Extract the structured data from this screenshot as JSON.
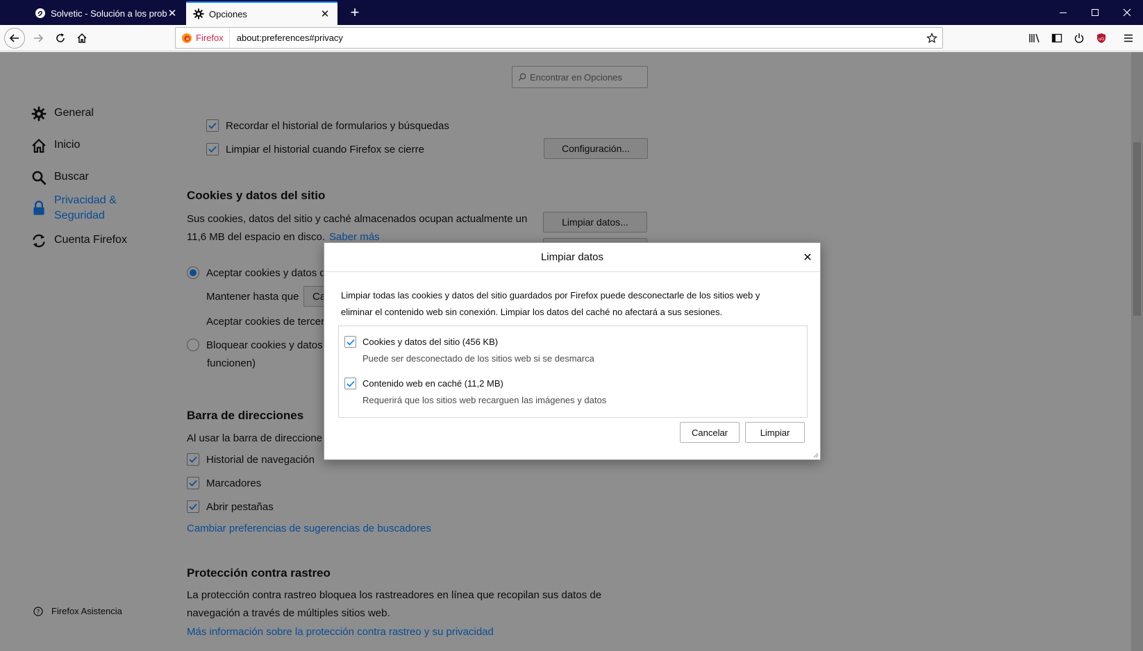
{
  "browser": {
    "tabs": [
      {
        "label": "Solvetic - Solución a los proble",
        "active": false,
        "icon": "solvetic-icon"
      },
      {
        "label": "Opciones",
        "active": true,
        "icon": "gear-icon"
      }
    ],
    "identity_label": "Firefox",
    "url": "about:preferences#privacy"
  },
  "prefs": {
    "search_placeholder": "Encontrar en Opciones",
    "categories": [
      {
        "label": "General",
        "icon": "gear-icon"
      },
      {
        "label": "Inicio",
        "icon": "home-icon"
      },
      {
        "label": "Buscar",
        "icon": "search-icon"
      },
      {
        "label": "Privacidad & Seguridad",
        "icon": "lock-icon",
        "selected": true
      },
      {
        "label": "Cuenta Firefox",
        "icon": "sync-icon"
      }
    ],
    "support_label": "Firefox Asistencia",
    "history": {
      "remember_forms": "Recordar el historial de formularios y búsquedas",
      "clear_on_close": "Limpiar el historial cuando Firefox se cierre",
      "settings_button": "Configuración..."
    },
    "cookies": {
      "heading": "Cookies y datos del sitio",
      "desc_line1": "Sus cookies, datos del sitio y caché almacenados ocupan actualmente un",
      "desc_line2": "11,6 MB del espacio en disco.",
      "learn_more": "Saber más",
      "clear_button": "Limpiar datos...",
      "accept_label": "Aceptar cookies y datos d",
      "keep_until": "Mantener hasta que",
      "keep_select": "Ca",
      "third_party": "Aceptar cookies de tercer",
      "block_line1": "Bloquear cookies y datos",
      "block_line2": "funcionen)"
    },
    "address_bar": {
      "heading": "Barra de direcciones",
      "desc": "Al usar la barra de direccione",
      "history": "Historial de navegación",
      "bookmarks": "Marcadores",
      "open_tabs": "Abrir pestañas",
      "change_link": "Cambiar preferencias de sugerencias de buscadores"
    },
    "tracking": {
      "heading": "Protección contra rastreo",
      "desc_line1": "La protección contra rastreo bloquea los rastreadores en línea que recopilan sus datos de",
      "desc_line2": "navegación a través de múltiples sitios web.",
      "more_link": "Más información sobre la protección contra rastreo y su privacidad"
    }
  },
  "dialog": {
    "title": "Limpiar datos",
    "desc_line1": "Limpiar todas las cookies y datos del sitio guardados por Firefox puede desconectarle de los sitios web y",
    "desc_line2": "eliminar el contenido web sin conexión. Limpiar los datos del caché no afectará a sus sesiones.",
    "items": [
      {
        "label": "Cookies y datos del sitio (456 KB)",
        "sub": "Puede ser desconectado de los sitios web si se desmarca",
        "checked": true
      },
      {
        "label": "Contenido web en caché (11,2 MB)",
        "sub": "Requerirá que los sitios web recarguen las imágenes y datos",
        "checked": true
      }
    ],
    "cancel_label": "Cancelar",
    "clear_label": "Limpiar"
  },
  "colors": {
    "accent": "#0a84ff",
    "tabstrip": "#0c0c3d",
    "firefox_label": "#d7264c"
  }
}
